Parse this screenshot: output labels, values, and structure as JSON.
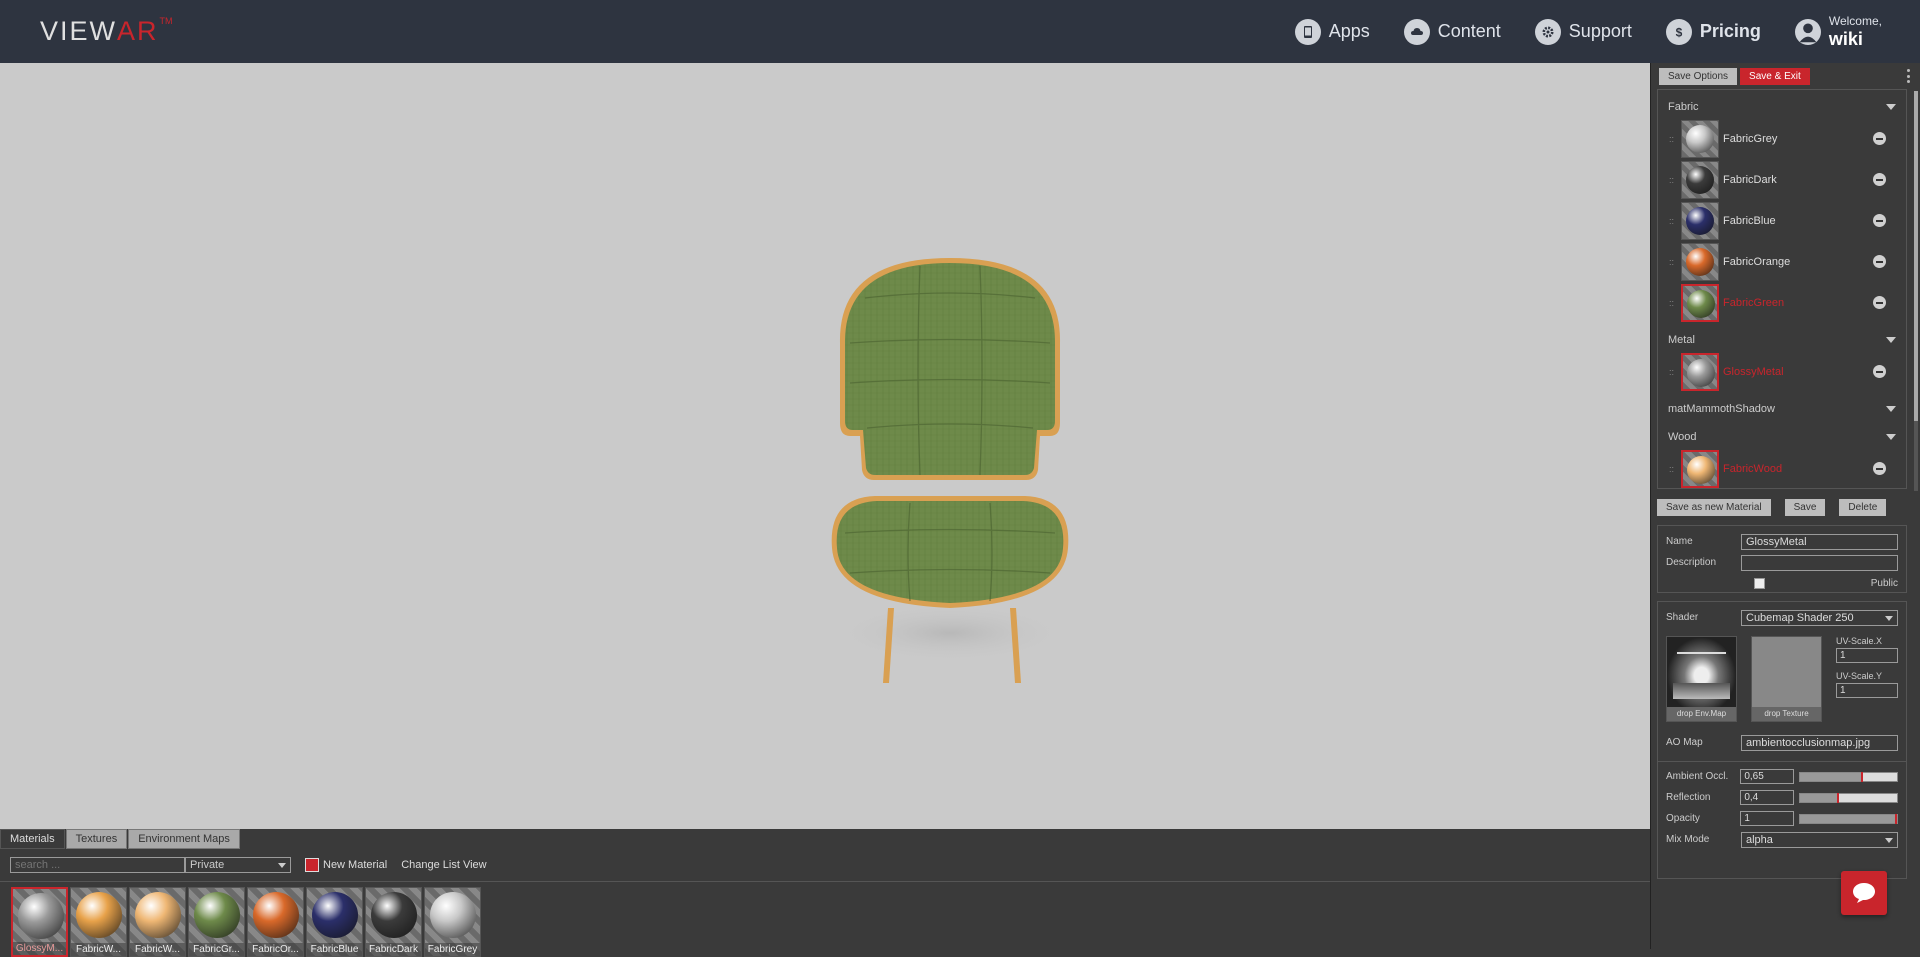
{
  "header": {
    "logo_text_a": "VIEW",
    "logo_text_b": "AR",
    "logo_tm": "TM",
    "nav": [
      {
        "label": "Apps",
        "icon": "tablet-icon"
      },
      {
        "label": "Content",
        "icon": "cloud-icon"
      },
      {
        "label": "Support",
        "icon": "gear-icon"
      },
      {
        "label": "Pricing",
        "icon": "dollar-icon"
      }
    ],
    "welcome_label": "Welcome,",
    "username": "wiki"
  },
  "library": {
    "tabs": [
      "Materials",
      "Textures",
      "Environment Maps"
    ],
    "active_tab": "Materials",
    "search_placeholder": "search ...",
    "filter_value": "Private",
    "new_material_label": "New Material",
    "change_view_label": "Change List View",
    "items": [
      {
        "label": "GlossyM...",
        "color": "#9a9a9a",
        "selected": true
      },
      {
        "label": "FabricW...",
        "color": "#e8a24a",
        "selected": false
      },
      {
        "label": "FabricW...",
        "color": "#efb774",
        "selected": false
      },
      {
        "label": "FabricGr...",
        "color": "#6e8a4a",
        "selected": false
      },
      {
        "label": "FabricOr...",
        "color": "#d9692a",
        "selected": false
      },
      {
        "label": "FabricBlue",
        "color": "#2b2f6a",
        "selected": false
      },
      {
        "label": "FabricDark",
        "color": "#3b3b3b",
        "selected": false
      },
      {
        "label": "FabricGrey",
        "color": "#c8c8c8",
        "selected": false
      }
    ]
  },
  "panel": {
    "save_options_label": "Save Options",
    "save_exit_label": "Save & Exit",
    "groups": [
      {
        "name": "Fabric",
        "materials": [
          {
            "name": "FabricGrey",
            "color": "#c8c8c8",
            "selected": false
          },
          {
            "name": "FabricDark",
            "color": "#3b3b3b",
            "selected": false
          },
          {
            "name": "FabricBlue",
            "color": "#2b2f6a",
            "selected": false
          },
          {
            "name": "FabricOrange",
            "color": "#d9692a",
            "selected": false
          },
          {
            "name": "FabricGreen",
            "color": "#6e8a4a",
            "selected": true
          }
        ]
      },
      {
        "name": "Metal",
        "materials": [
          {
            "name": "GlossyMetal",
            "color": "#9a9a9a",
            "selected": true
          }
        ]
      },
      {
        "name": "matMammothShadow",
        "materials": []
      },
      {
        "name": "Wood",
        "materials": [
          {
            "name": "FabricWood",
            "color": "#efb774",
            "selected": true
          }
        ]
      }
    ],
    "save_new_label": "Save as new Material",
    "save_label": "Save",
    "delete_label": "Delete",
    "name_label": "Name",
    "name_value": "GlossyMetal",
    "description_label": "Description",
    "description_value": "",
    "public_label": "Public",
    "shader_label": "Shader",
    "shader_value": "Cubemap Shader 250",
    "drop_envmap_label": "drop Env.Map",
    "drop_texture_label": "drop Texture",
    "uvx_label": "UV-Scale.X",
    "uvx_value": "1",
    "uvy_label": "UV-Scale.Y",
    "uvy_value": "1",
    "ao_map_label": "AO Map",
    "ao_map_value": "ambientocclusionmap.jpg",
    "ambient_label": "Ambient Occl.",
    "ambient_value": "0,65",
    "ambient_level": 0.65,
    "reflection_label": "Reflection",
    "reflection_value": "0,4",
    "reflection_level": 0.4,
    "opacity_label": "Opacity",
    "opacity_value": "1",
    "opacity_level": 1,
    "mixmode_label": "Mix Mode",
    "mixmode_value": "alpha"
  },
  "colors": {
    "accent": "#c9252c",
    "topbar": "#2e3440",
    "viewport": "#cacaca",
    "chair_fabric": "#6e8a4a",
    "chair_wood": "#e2a85a"
  }
}
